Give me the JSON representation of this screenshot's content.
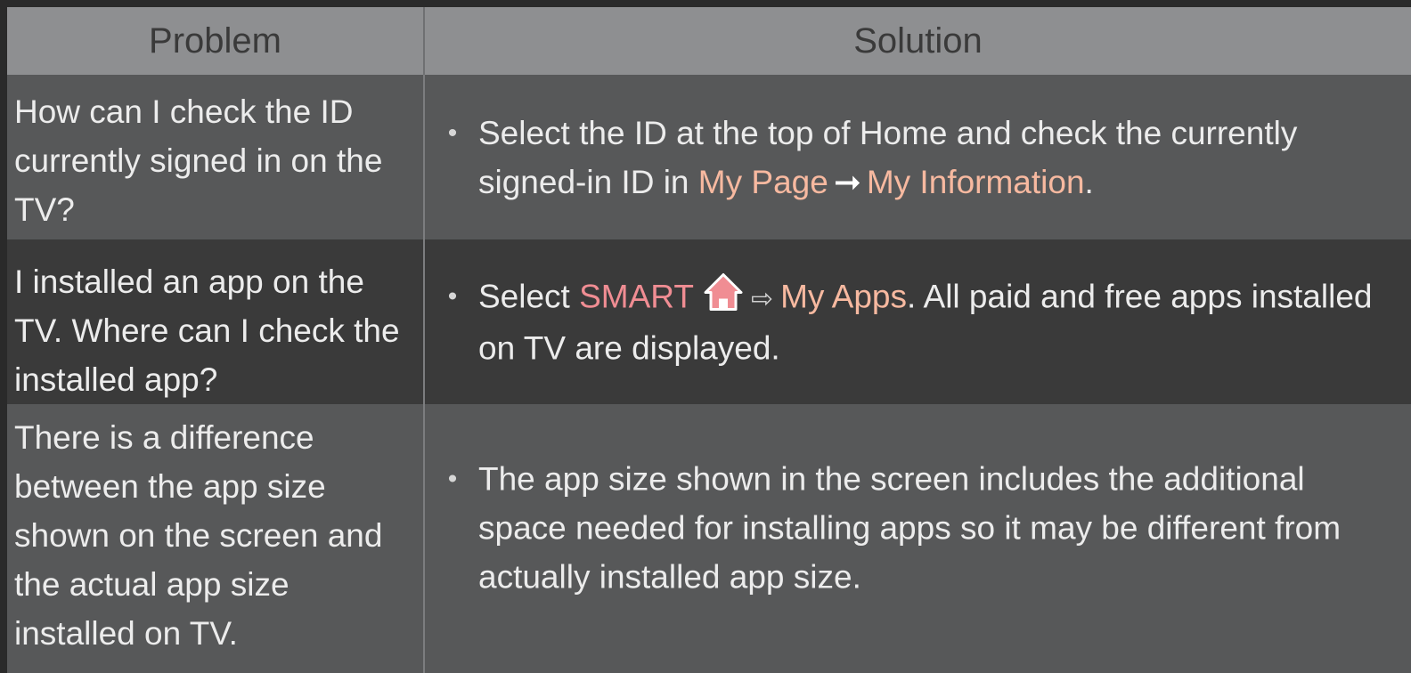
{
  "header": {
    "problem": "Problem",
    "solution": "Solution"
  },
  "rows": [
    {
      "problem": "How can I check the ID currently signed in on the TV?",
      "solution": {
        "text_1": "Select the ID at the top of Home and check the currently signed-in ID in ",
        "link_1": "My Page",
        "arrow": "➞",
        "link_2": "My Information",
        "end": "."
      }
    },
    {
      "problem": "I installed an app on the TV. Where can I check the installed app?",
      "solution": {
        "text_1": "Select ",
        "smart": "SMART",
        "icon": "home-icon",
        "arrow": "⇨",
        "link_1": "My Apps",
        "text_2": ". All paid and free apps installed on TV are displayed."
      }
    },
    {
      "problem": "There is a difference between the app size shown on the screen and the actual app size installed on TV.",
      "solution": {
        "text_1": "The app size shown in the screen includes the additional space needed for installing apps so it may be different from actually installed app size."
      }
    }
  ],
  "bullet": "•",
  "colors": {
    "header_bg": "#8e8f91",
    "row_light_bg": "#575859",
    "row_dark_bg": "#3a3a3a",
    "highlight_peach": "#f7b9a0",
    "highlight_pink": "#f08d93"
  }
}
